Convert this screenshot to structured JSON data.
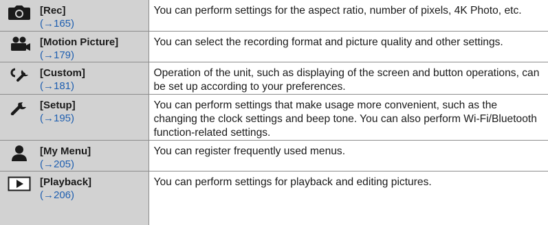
{
  "rows": [
    {
      "icon": "camera-icon",
      "label": "[Rec]",
      "ref": "(→165)",
      "description": "You can perform settings for the aspect ratio, number of pixels, 4K Photo, etc."
    },
    {
      "icon": "motion-picture-icon",
      "label": "[Motion Picture]",
      "ref": "(→179)",
      "description": "You can select the recording format and picture quality and other settings."
    },
    {
      "icon": "custom-icon",
      "label": "[Custom]",
      "ref": "(→181)",
      "description": "Operation of the unit, such as displaying of the screen and button operations, can be set up according to your preferences."
    },
    {
      "icon": "wrench-icon",
      "label": "[Setup]",
      "ref": "(→195)",
      "description": "You can perform settings that make usage more convenient, such as the changing the clock settings and beep tone. You can also perform Wi-Fi/Bluetooth function-related settings."
    },
    {
      "icon": "person-icon",
      "label": "[My Menu]",
      "ref": "(→205)",
      "description": "You can register frequently used menus."
    },
    {
      "icon": "playback-icon",
      "label": "[Playback]",
      "ref": "(→206)",
      "description": "You can perform settings for playback and editing pictures."
    }
  ]
}
